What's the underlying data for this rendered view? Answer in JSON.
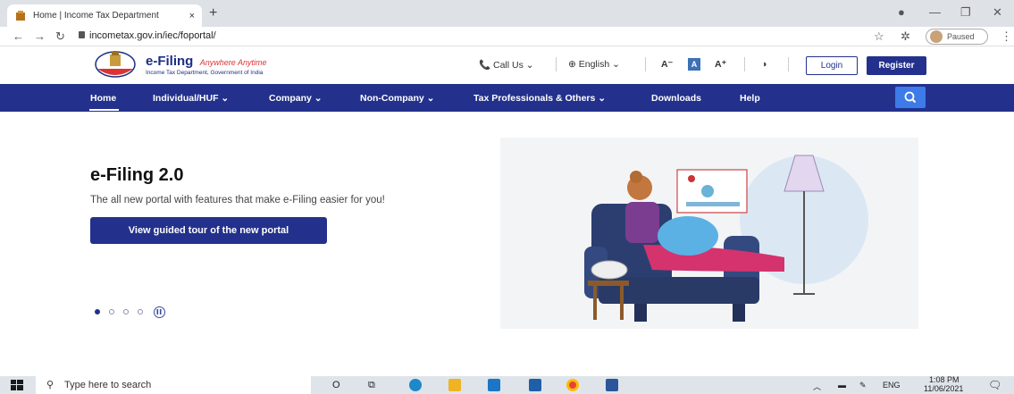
{
  "browser": {
    "tab_title": "Home | Income Tax Department",
    "tab_close": "×",
    "new_tab": "+",
    "url": "incometax.gov.in/iec/foportal/",
    "profile_status": "Paused"
  },
  "header": {
    "brand_name": "e-Filing",
    "brand_tagline": "Anywhere Anytime",
    "brand_sub": "Income Tax Department, Government of India",
    "call_us": "Call Us",
    "language": "English",
    "font_decrease": "A",
    "font_normal": "A",
    "font_increase": "A",
    "login": "Login",
    "register": "Register"
  },
  "nav": {
    "items": [
      "Home",
      "Individual/HUF",
      "Company",
      "Non-Company",
      "Tax Professionals & Others",
      "Downloads",
      "Help"
    ],
    "dropdown_marker": "⌄"
  },
  "hero": {
    "title": "e-Filing 2.0",
    "subtitle": "The all new portal with features that make e-Filing easier for you!",
    "cta": "View guided tour of the new portal",
    "slides_total": 4,
    "slide_active": 1
  },
  "taskbar": {
    "search_placeholder": "Type here to search",
    "lang": "ENG",
    "time": "1:08 PM",
    "date": "11/06/2021"
  },
  "colors": {
    "brand_navy": "#23318c",
    "search_blue": "#3c7be8",
    "browser_chrome": "#dee1e6"
  }
}
